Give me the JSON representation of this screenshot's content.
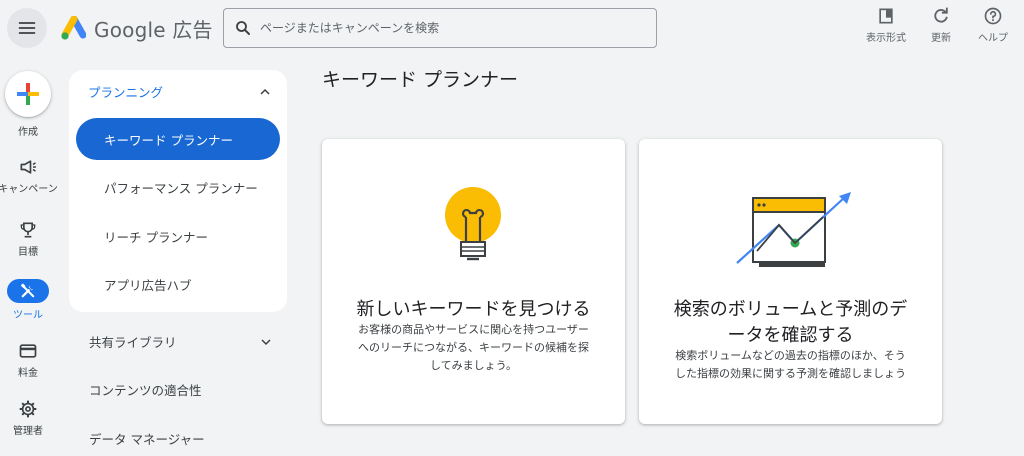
{
  "header": {
    "product_name": "Google 広告",
    "search_placeholder": "ページまたはキャンペーンを検索",
    "actions": [
      {
        "label": "表示形式",
        "icon": "view-format-icon"
      },
      {
        "label": "更新",
        "icon": "refresh-icon"
      },
      {
        "label": "ヘルプ",
        "icon": "help-icon"
      }
    ]
  },
  "rail": {
    "create": "作成",
    "campaigns": "キャンペーン",
    "goals": "目標",
    "tools": "ツール",
    "billing": "料金",
    "admin": "管理者"
  },
  "nav": {
    "planning": "プランニング",
    "items": [
      "キーワード プランナー",
      "パフォーマンス プランナー",
      "リーチ プランナー",
      "アプリ広告ハブ"
    ],
    "shared_library": "共有ライブラリ",
    "content_suitability": "コンテンツの適合性",
    "data_manager": "データ マネージャー"
  },
  "main": {
    "title": "キーワード プランナー",
    "cards": [
      {
        "title": "新しいキーワードを見つける",
        "desc": [
          "お客様の商品やサービスに関心を持つユーザー",
          "へのリーチにつながる、キーワードの候補を探",
          "してみましょう。"
        ]
      },
      {
        "title": [
          "検索のボリュームと予測のデ",
          "ータを確認する"
        ],
        "desc": [
          "検索ボリュームなどの過去の指標のほか、そう",
          "した指標の効果に関する予測を確認しましょう"
        ]
      }
    ]
  },
  "colors": {
    "accent": "#1a73e8",
    "active_nav": "#1967d2",
    "bulb": "#fbbc04",
    "chart_green": "#34a853"
  }
}
